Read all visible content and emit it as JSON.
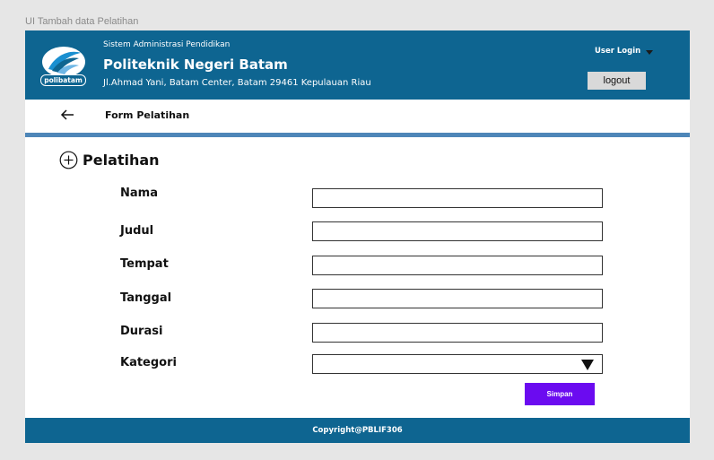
{
  "frame_label": "UI Tambah data Pelatihan",
  "header": {
    "logo_text": "polibatam",
    "subtitle": "Sistem Administrasi Pendidikan",
    "title": "Politeknik Negeri Batam",
    "address": "Jl.Ahmad Yani, Batam Center, Batam 29461 Kepulauan Riau",
    "user_login": "User Login",
    "logout": "logout"
  },
  "subbar": {
    "title": "Form Pelatihan"
  },
  "section": {
    "title": "Pelatihan"
  },
  "form": {
    "fields": [
      {
        "label": "Nama",
        "value": ""
      },
      {
        "label": "Judul",
        "value": ""
      },
      {
        "label": "Tempat",
        "value": ""
      },
      {
        "label": "Tanggal",
        "value": ""
      },
      {
        "label": "Durasi",
        "value": ""
      },
      {
        "label": "Kategori",
        "value": ""
      }
    ],
    "submit": "Simpan"
  },
  "footer": {
    "text": "Copyright@PBLIF306"
  },
  "colors": {
    "header_bg": "#0e6591",
    "accent_line": "#4e86b8",
    "submit_bg": "#6b0bf0"
  }
}
